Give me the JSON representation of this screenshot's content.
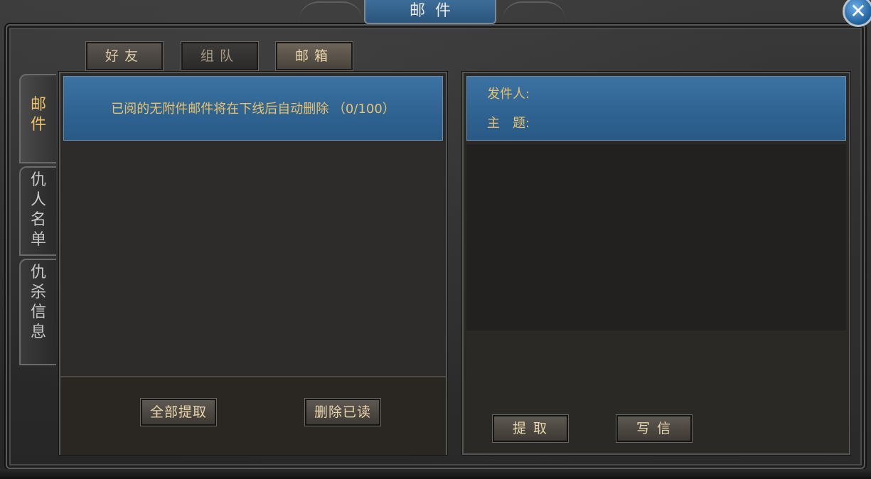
{
  "window": {
    "title": "邮件",
    "close_icon": "close-icon"
  },
  "top_tabs": [
    {
      "label": "好友",
      "state": "normal"
    },
    {
      "label": "组队",
      "state": "dim"
    },
    {
      "label": "邮箱",
      "state": "active"
    }
  ],
  "side_tabs": [
    {
      "label": "邮件",
      "active": true
    },
    {
      "label": "仇人名单",
      "active": false
    },
    {
      "label": "仇杀信息",
      "active": false
    }
  ],
  "mail_list": {
    "notice": "已阅的无附件邮件将在下线后自动删除 （0/100）",
    "items": []
  },
  "left_actions": {
    "collect_all": "全部提取",
    "delete_read": "删除已读"
  },
  "mail_detail": {
    "sender_label": "发件人:",
    "sender_value": "",
    "subject_label": "主　题:",
    "subject_value": "",
    "body": ""
  },
  "right_actions": {
    "collect": "提取",
    "compose": "写信"
  },
  "colors": {
    "accent_blue": "#2e6291",
    "text_gold": "#e9c26a",
    "button_text": "#e9d7ae",
    "panel_bg": "#2d2b29"
  }
}
